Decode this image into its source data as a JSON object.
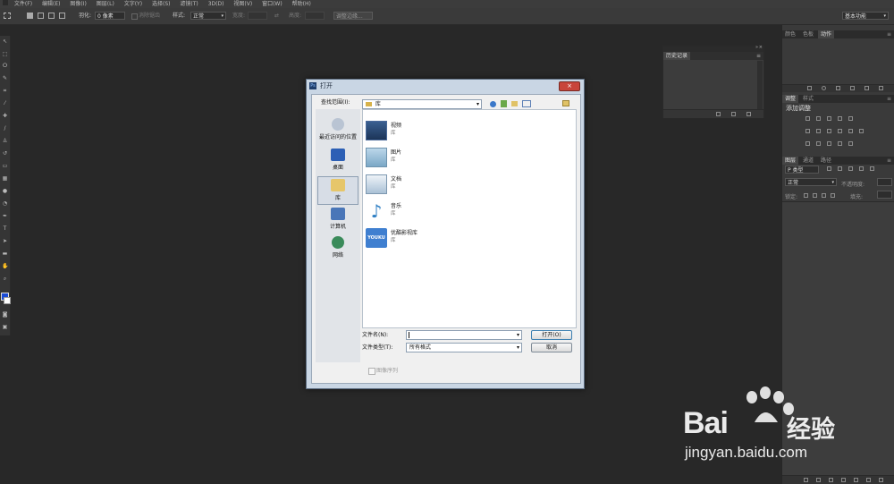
{
  "menubar": {
    "items": [
      "文件(F)",
      "编辑(E)",
      "图像(I)",
      "图层(L)",
      "文字(Y)",
      "选择(S)",
      "滤镜(T)",
      "3D(D)",
      "视图(V)",
      "窗口(W)",
      "帮助(H)"
    ]
  },
  "options": {
    "feather_label": "羽化:",
    "feather_value": "0 像素",
    "antialias_label": "消除锯齿",
    "style_label": "样式:",
    "style_value": "正常",
    "width_label": "宽度:",
    "height_label": "高度:",
    "refine_edge_button": "调整边缘...",
    "workspace_value": "基本功能"
  },
  "panels": {
    "top_tabs": [
      "颜色",
      "色板",
      "动作"
    ],
    "adjust_tabs": [
      "调整",
      "样式"
    ],
    "adjust_title": "添加调整",
    "layers_tabs": [
      "图层",
      "通道",
      "路径"
    ],
    "layers_kind": "P 类型",
    "blend_mode": "正常",
    "opacity_label": "不透明度:",
    "lock_label": "锁定:",
    "fill_label": "填充:"
  },
  "history_panel": {
    "tab": "历史记录"
  },
  "dialog": {
    "title": "打开",
    "look_in_label": "查找范围(I):",
    "look_in_value": "库",
    "places": [
      "最近访问的位置",
      "桌面",
      "库",
      "计算机",
      "网络"
    ],
    "files": [
      {
        "name": "视频",
        "type": "库"
      },
      {
        "name": "图片",
        "type": "库"
      },
      {
        "name": "文档",
        "type": "库"
      },
      {
        "name": "音乐",
        "type": "库"
      },
      {
        "name": "优酷影视库",
        "type": "库"
      }
    ],
    "youku_logo_text": "YOUKU",
    "filename_label": "文件名(N):",
    "filename_value": "",
    "filetype_label": "文件类型(T):",
    "filetype_value": "所有格式",
    "open_button": "打开(O)",
    "cancel_button": "取消",
    "image_sequence_label": "图像序列"
  },
  "watermark": {
    "brand": "Bai",
    "brand2": "经验",
    "url": "jingyan.baidu.com"
  },
  "colors": {
    "background": "#282828",
    "dialog_frame": "#c9d6e4",
    "close_button": "#c8453b",
    "baidu_blue": "#2b5ec9",
    "baidu_red": "#e0322a"
  }
}
